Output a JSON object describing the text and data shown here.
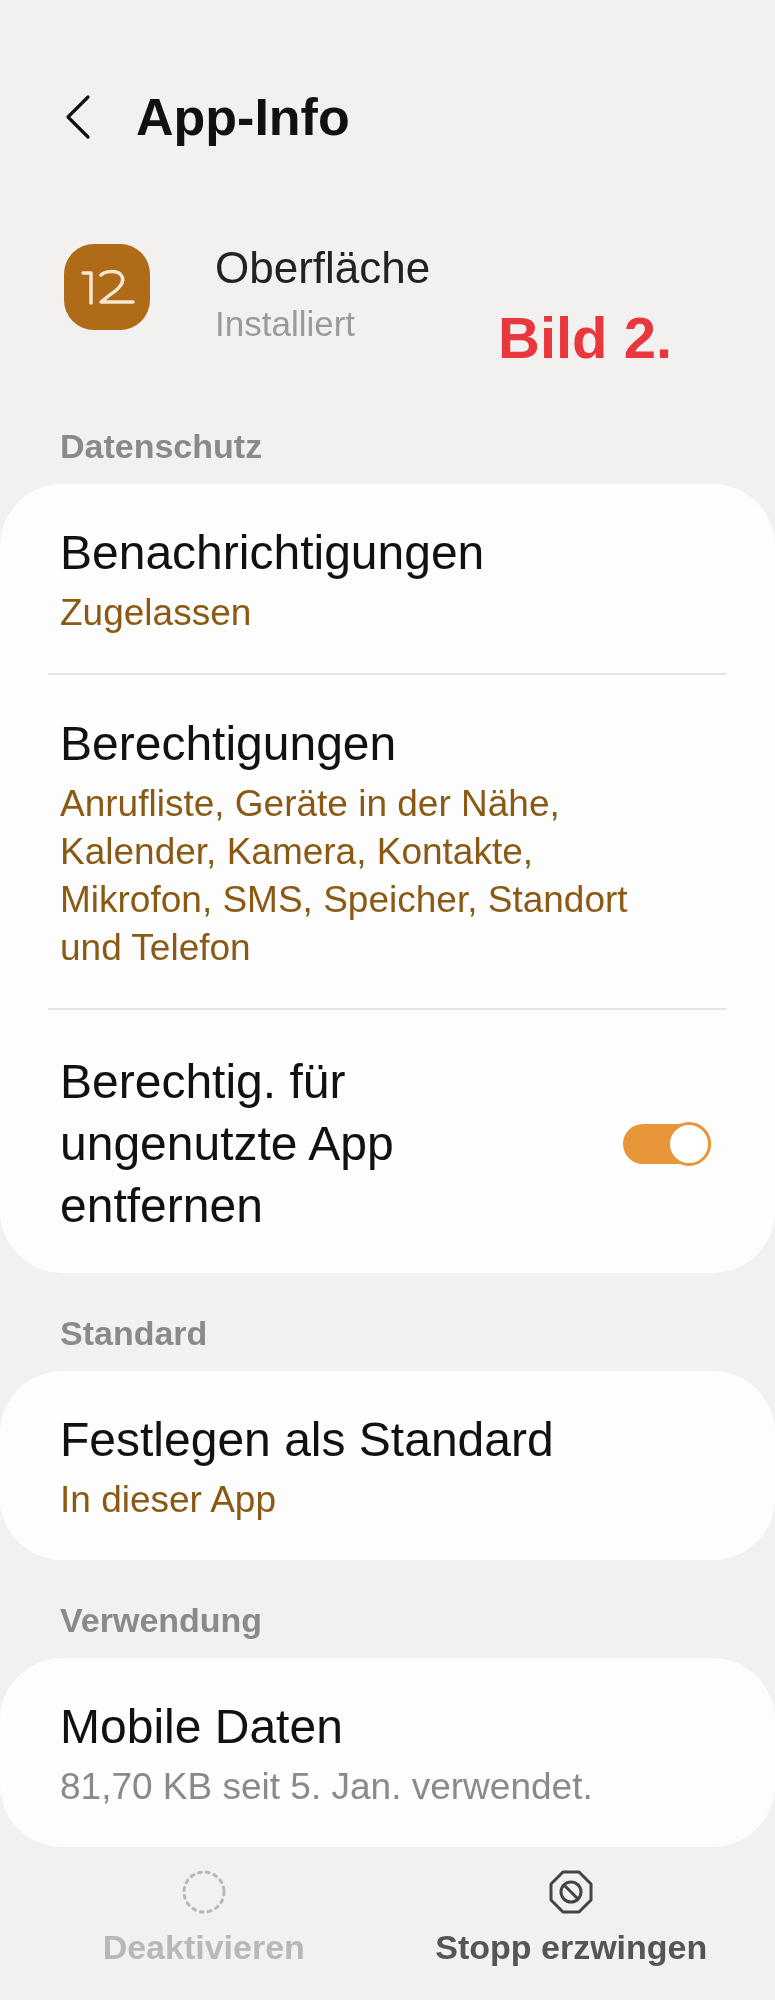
{
  "header": {
    "title": "App-Info"
  },
  "app": {
    "name": "Oberfläche",
    "status": "Installiert"
  },
  "annotation": "Bild 2.",
  "sections": [
    {
      "title": "Datenschutz",
      "items": [
        {
          "kind": "link",
          "title": "Benachrichtigungen",
          "subtitle": "Zugelassen",
          "color": "#8a5a14"
        },
        {
          "kind": "link",
          "title": "Berechtigungen",
          "subtitle": "Anrufliste, Geräte in der Nähe, Kalender, Kamera, Kontakte, Mikrofon, SMS, Speicher, Standort und Telefon",
          "color": "#8a5a14"
        },
        {
          "kind": "toggle",
          "title": "Berechtig. für ungenutzte App entfernen",
          "on": true
        }
      ]
    },
    {
      "title": "Standard",
      "items": [
        {
          "kind": "link",
          "title": "Festlegen als Standard",
          "subtitle": "In dieser App",
          "color": "#8a5a14"
        }
      ]
    },
    {
      "title": "Verwendung",
      "items": [
        {
          "kind": "link",
          "title": "Mobile Daten",
          "subtitle": "81,70 KB seit 5. Jan. verwendet.",
          "color": "#8a8a8a"
        }
      ]
    }
  ],
  "bottom_actions": [
    {
      "kind": "disable",
      "label": "Deaktivieren",
      "disabled": true
    },
    {
      "kind": "force_stop",
      "label": "Stopp erzwingen",
      "disabled": false
    }
  ]
}
